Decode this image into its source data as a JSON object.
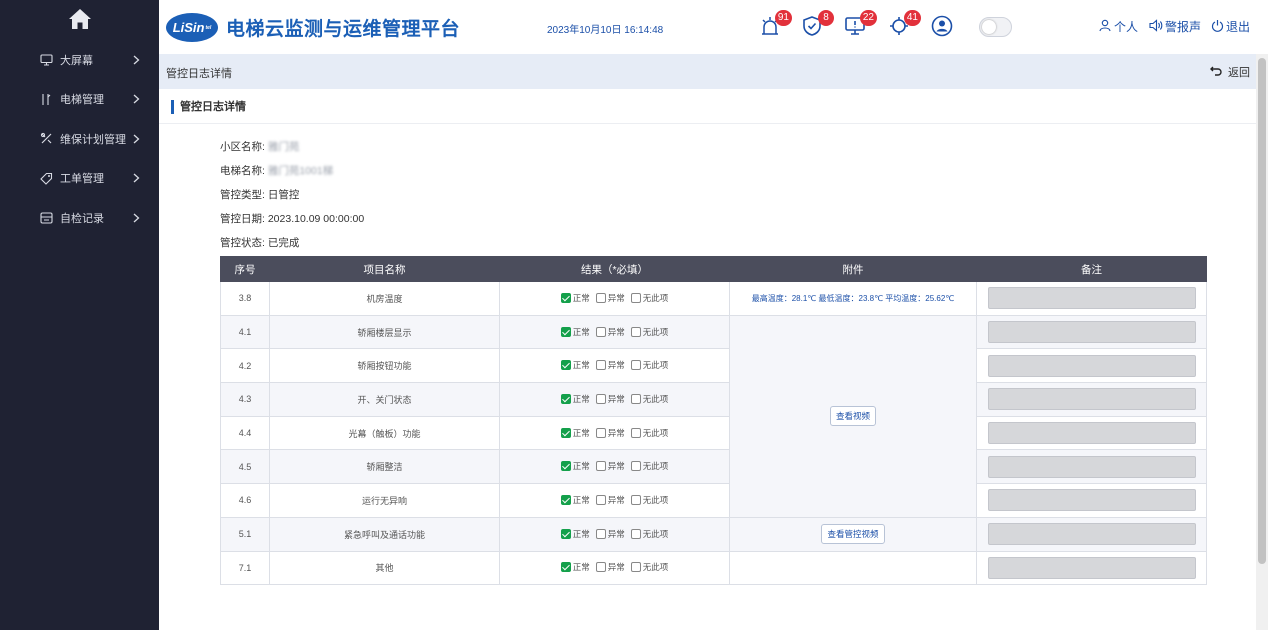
{
  "sidebar": {
    "home_icon": "home-icon",
    "items": [
      {
        "label": "大屏幕",
        "icon": "monitor-icon"
      },
      {
        "label": "电梯管理",
        "icon": "elevator-icon"
      },
      {
        "label": "维保计划管理",
        "icon": "tools-icon"
      },
      {
        "label": "工单管理",
        "icon": "tag-icon"
      },
      {
        "label": "自检记录",
        "icon": "record-icon"
      }
    ]
  },
  "header": {
    "logo_text": "LiSin",
    "logo_sup": "tel",
    "title": "电梯云监测与运维管理平台",
    "datetime": "2023年10月10日 16:14:48",
    "badges": [
      {
        "icon": "alarm-light-icon",
        "count": "91"
      },
      {
        "icon": "shield-check-icon",
        "count": "8"
      },
      {
        "icon": "screen-alert-icon",
        "count": "22"
      },
      {
        "icon": "maintenance-icon",
        "count": "41"
      },
      {
        "icon": "user-circle-icon",
        "count": ""
      }
    ],
    "personal_label": "个人",
    "alarm_sound_label": "警报声",
    "logout_label": "退出"
  },
  "breadcrumb": {
    "title": "管控日志详情",
    "back_label": "返回"
  },
  "section": {
    "title": "管控日志详情"
  },
  "info": {
    "community": {
      "label": "小区名称:",
      "value": "雅门苑"
    },
    "elevator": {
      "label": "电梯名称:",
      "value": "雅门苑1001梯"
    },
    "type": {
      "label": "管控类型:",
      "value": "日管控"
    },
    "date": {
      "label": "管控日期:",
      "value": "2023.10.09 00:00:00"
    },
    "status": {
      "label": "管控状态:",
      "value": "已完成"
    }
  },
  "table": {
    "headers": [
      "序号",
      "项目名称",
      "结果（*必填）",
      "附件",
      "备注"
    ],
    "options": [
      "正常",
      "异常",
      "无此项"
    ],
    "rows": [
      {
        "no": "3.8",
        "name": "机房温度",
        "result": "正常"
      },
      {
        "no": "4.1",
        "name": "轿厢楼层显示",
        "result": "正常"
      },
      {
        "no": "4.2",
        "name": "轿厢按钮功能",
        "result": "正常"
      },
      {
        "no": "4.3",
        "name": "开、关门状态",
        "result": "正常"
      },
      {
        "no": "4.4",
        "name": "光幕（触板）功能",
        "result": "正常"
      },
      {
        "no": "4.5",
        "name": "轿厢整洁",
        "result": "正常"
      },
      {
        "no": "4.6",
        "name": "运行无异响",
        "result": "正常"
      },
      {
        "no": "5.1",
        "name": "紧急呼叫及通话功能",
        "result": "正常"
      },
      {
        "no": "7.1",
        "name": "其他",
        "result": "正常"
      }
    ],
    "temperature_text": "最高温度：28.1℃  最低温度：23.8℃  平均温度：25.62℃",
    "view_video_label": "查看视频",
    "view_control_video_label": "查看管控视频"
  },
  "colors": {
    "brand": "#1b5fb6",
    "sidebar_bg": "#1f2233",
    "table_header_bg": "#4b4d5c",
    "badge": "#e2313b",
    "checked": "#14a04b"
  }
}
